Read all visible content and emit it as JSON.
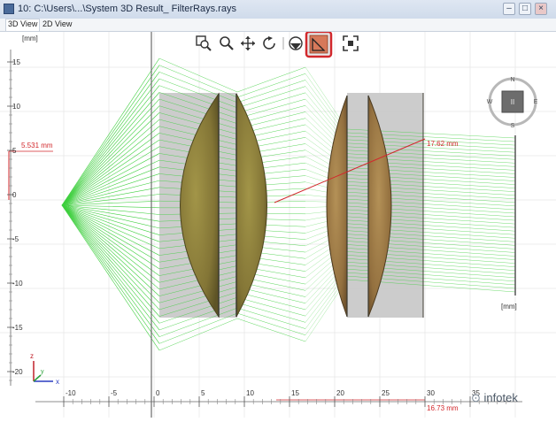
{
  "window": {
    "title": "10: C:\\Users\\...\\System 3D Result_ FilterRays.rays",
    "buttons": [
      "minimize",
      "restore",
      "close"
    ]
  },
  "tabs": [
    {
      "label": "3D View",
      "active": true
    },
    {
      "label": "2D View",
      "active": false
    }
  ],
  "toolbar": {
    "tools": [
      {
        "name": "zoom-window-icon"
      },
      {
        "name": "zoom-icon"
      },
      {
        "name": "pan-icon"
      },
      {
        "name": "rotate-icon"
      },
      {
        "name": "view-mode-icon"
      },
      {
        "name": "measure-icon",
        "active": true,
        "highlight_color": "#d2282c"
      },
      {
        "name": "fit-extents-icon"
      }
    ]
  },
  "navcube": {
    "face_label": "II",
    "compass": [
      "N",
      "E",
      "S",
      "W"
    ]
  },
  "axes": {
    "vertical_unit": "[mm]",
    "horizontal_unit": "[mm]",
    "y_ticks": [
      "15",
      "10",
      "5",
      "0",
      "-5",
      "-10",
      "-15",
      "-20"
    ],
    "x_ticks": [
      "-10",
      "-5",
      "0",
      "5",
      "10",
      "15",
      "20",
      "25",
      "30",
      "35"
    ]
  },
  "measurements": {
    "height_label": "5.531 mm",
    "diagonal_label": "17.62 mm",
    "bottom_label": "16.73 mm",
    "color": "#d2282c"
  },
  "colors": {
    "ray": "#3fcf3f",
    "lens": "#8a7c3c",
    "housing": "#c4c4c4"
  },
  "watermark": "infotek"
}
